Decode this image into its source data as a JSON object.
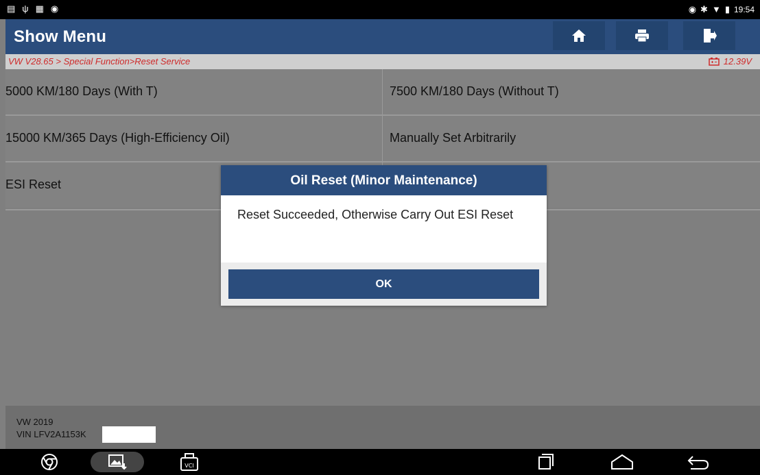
{
  "status_bar": {
    "time": "19:54",
    "left_icons": [
      "screen-icon",
      "usb-icon",
      "sd-icon",
      "debug-icon"
    ],
    "right_icons": [
      "location-icon",
      "bluetooth-icon",
      "wifi-icon",
      "battery-icon"
    ]
  },
  "header": {
    "title": "Show Menu",
    "buttons": [
      "home-icon",
      "print-icon",
      "exit-icon"
    ]
  },
  "breadcrumb": {
    "path": "VW V28.65 > Special Function>Reset Service",
    "voltage": "12.39V"
  },
  "menu": {
    "items": [
      {
        "label": "5000 KM/180 Days (With T)"
      },
      {
        "label": "7500 KM/180 Days (Without T)"
      },
      {
        "label": "15000 KM/365 Days (High-Efficiency Oil)"
      },
      {
        "label": "Manually Set Arbitrarily"
      },
      {
        "label": "ESI Reset"
      }
    ]
  },
  "footer": {
    "line1": "VW  2019",
    "line2": "VIN LFV2A1153K"
  },
  "dialog": {
    "title": "Oil Reset (Minor Maintenance)",
    "message": "Reset Succeeded, Otherwise Carry Out ESI Reset",
    "ok_label": "OK"
  },
  "navbar": {
    "buttons": [
      "chrome-icon",
      "gallery-icon",
      "vci-icon",
      "recent-apps-icon",
      "home-nav-icon",
      "back-icon"
    ],
    "vci_label": "VCI"
  },
  "colors": {
    "header_blue": "#2b4d7d",
    "breadcrumb_red": "#cf2a2a",
    "menu_gray": "#828282"
  }
}
